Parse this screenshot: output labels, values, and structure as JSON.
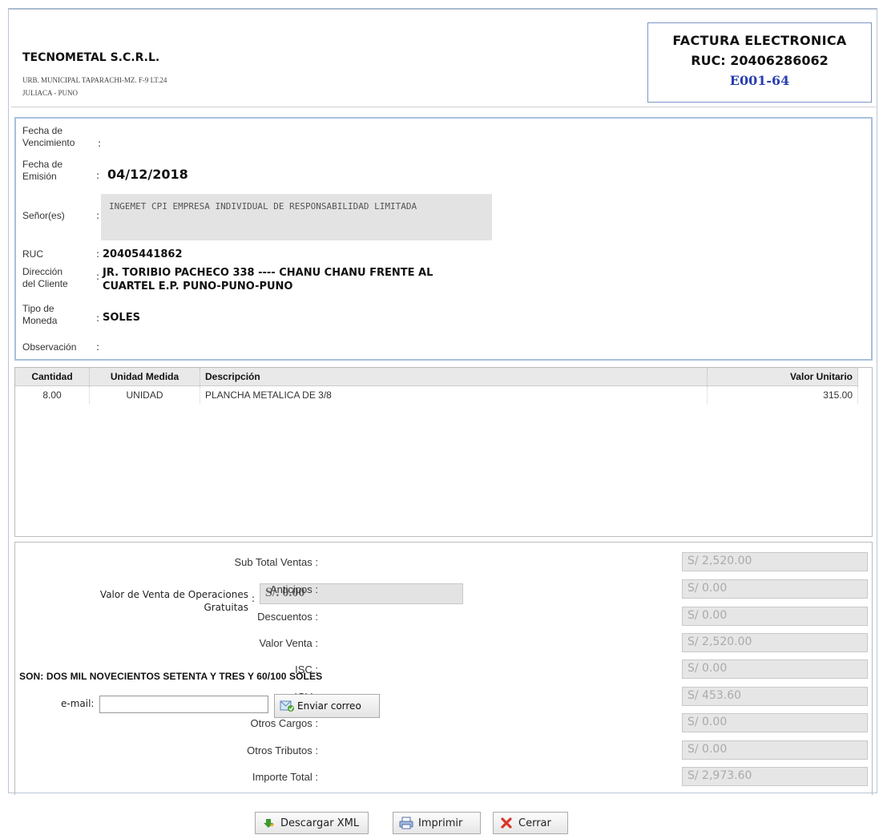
{
  "company": {
    "name": "TECNOMETAL S.C.R.L.",
    "address_line1": "URB. MUNICIPAL TAPARACHI-MZ. F-9 LT.24",
    "address_line2": "JULIACA - PUNO"
  },
  "document": {
    "type": "FACTURA ELECTRONICA",
    "ruc": "RUC: 20406286062",
    "number": "E001-64"
  },
  "client": {
    "fecha_vencimiento_label": "Fecha de Vencimiento",
    "fecha_vencimiento_value": "",
    "fecha_emision_label": "Fecha de Emisión",
    "fecha_emision_value": "04/12/2018",
    "senores_label": "Señor(es)",
    "senores_value": "INGEMET CPI EMPRESA INDIVIDUAL DE RESPONSABILIDAD LIMITADA",
    "ruc_label": "RUC",
    "ruc_value": "20405441862",
    "direccion_label": "Dirección del Cliente",
    "direccion_value_line1": "JR. TORIBIO PACHECO 338 ---- CHANU CHANU FRENTE AL",
    "direccion_value_line2": "CUARTEL E.P. PUNO-PUNO-PUNO",
    "moneda_label": "Tipo de Moneda",
    "moneda_value": "SOLES",
    "observacion_label": "Observación",
    "observacion_value": ""
  },
  "items": {
    "headers": [
      "Cantidad",
      "Unidad Medida",
      "Descripción",
      "Valor Unitario"
    ],
    "rows": [
      [
        "8.00",
        "UNIDAD",
        "PLANCHA METALICA DE 3/8",
        "315.00"
      ]
    ]
  },
  "gratuitas": {
    "label_line1": "Valor de Venta de Operaciones",
    "label_line2": "Gratuitas",
    "value": "S/. 0.00"
  },
  "totals": [
    {
      "label": "Sub Total Ventas :",
      "value": "S/ 2,520.00"
    },
    {
      "label": "Anticipos :",
      "value": "S/ 0.00"
    },
    {
      "label": "Descuentos :",
      "value": "S/ 0.00"
    },
    {
      "label": "Valor Venta :",
      "value": "S/ 2,520.00"
    },
    {
      "label": "ISC :",
      "value": "S/ 0.00"
    },
    {
      "label": "IGV :",
      "value": "S/ 453.60"
    },
    {
      "label": "Otros Cargos :",
      "value": "S/ 0.00"
    },
    {
      "label": "Otros Tributos :",
      "value": "S/ 0.00"
    },
    {
      "label": "Importe Total :",
      "value": "S/ 2,973.60"
    }
  ],
  "son": "SON: DOS MIL NOVECIENTOS SETENTA Y TRES Y 60/100 SOLES",
  "email": {
    "label": "e-mail:",
    "value": "",
    "send_label": "Enviar correo"
  },
  "actions": {
    "download_xml": "Descargar XML",
    "print": "Imprimir",
    "close": "Cerrar"
  },
  "colors": {
    "doc_number": "#2a3fb0",
    "info_border": "#a7c0dd",
    "close_icon": "#d9362b",
    "download_icon": "#3a9a2e"
  }
}
